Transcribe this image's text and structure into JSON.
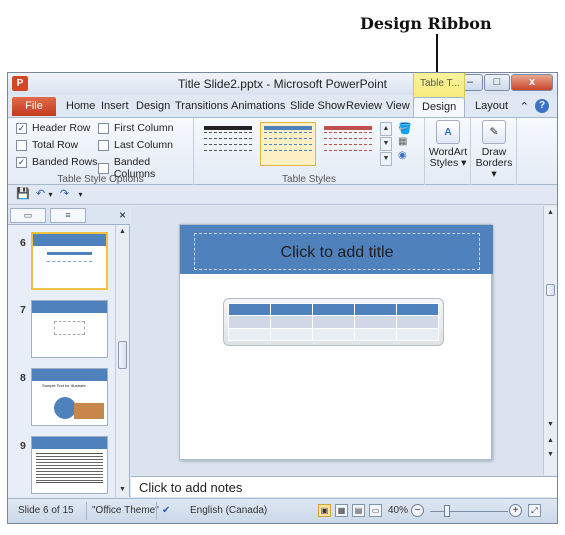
{
  "annotation": {
    "label": "Design Ribbon"
  },
  "window": {
    "app_icon": "P",
    "title": "Title Slide2.pptx - Microsoft PowerPoint",
    "context_header": "Table T...",
    "min": "–",
    "max": "□",
    "close": "x"
  },
  "tabs": {
    "file": "File",
    "home": "Home",
    "insert": "Insert",
    "design": "Design",
    "transitions": "Transitions",
    "animations": "Animations",
    "slideshow": "Slide Show",
    "review": "Review",
    "view": "View",
    "table_design": "Design",
    "layout": "Layout",
    "help": "?",
    "minimize_ribbon": "⌃"
  },
  "ribbon": {
    "options": {
      "header_row": "Header Row",
      "total_row": "Total Row",
      "banded_rows": "Banded Rows",
      "first_column": "First Column",
      "last_column": "Last Column",
      "banded_columns": "Banded Columns",
      "label": "Table Style Options",
      "check": "✓"
    },
    "styles": {
      "label": "Table Styles"
    },
    "wordart": {
      "line1": "WordArt",
      "line2": "Styles ▾",
      "icon": "A"
    },
    "borders": {
      "line1": "Draw",
      "line2": "Borders ▾",
      "icon": "✎"
    }
  },
  "qat": {
    "save": "💾",
    "undo": "↶",
    "redo": "↷",
    "more": "▾"
  },
  "thumbnails": {
    "close": "×",
    "slides": [
      {
        "num": "6"
      },
      {
        "num": "7"
      },
      {
        "num": "8",
        "text": "Sample Text for illustrate"
      },
      {
        "num": "9"
      }
    ]
  },
  "slide": {
    "title_placeholder": "Click to add title"
  },
  "notes": {
    "placeholder": "Click to add notes"
  },
  "status": {
    "slide_info": "Slide 6 of 15",
    "theme": "\"Office Theme\"",
    "language": "English (Canada)",
    "zoom": "40%",
    "zoom_out": "−",
    "zoom_in": "+"
  },
  "colors": {
    "accent": "#4f81bd",
    "file_tab": "#c13b1b",
    "context": "#f3e66a"
  }
}
